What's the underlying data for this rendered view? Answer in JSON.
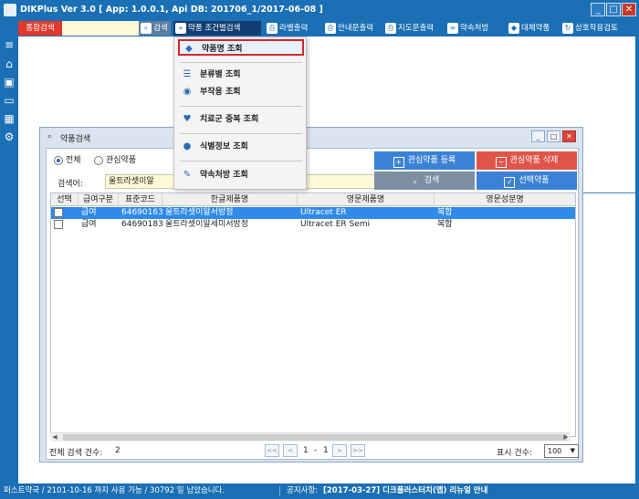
{
  "window": {
    "title": "DIKPlus Ver 3.0 [ App: 1.0.0.1, Api DB: 201706_1/2017-06-08 ]",
    "controls": [
      "_",
      "□",
      "✕"
    ]
  },
  "toolbar": {
    "integrated_search": "통합검색",
    "search": "검색",
    "drug_condition_search": "약품 조건별검색",
    "label_print": "라벨출력",
    "guide_print": "안내문출력",
    "instruction_print": "지도문출력",
    "promise_prescription": "약속처방",
    "substitute_drug": "대체약품",
    "interaction_check": "상호작용검토"
  },
  "menu": {
    "items": [
      {
        "label": "약품명 조회",
        "icon": "pill-tag-icon"
      },
      {
        "label": "분류별 조회",
        "icon": "list-icon"
      },
      {
        "label": "부작용 조회",
        "icon": "eye-icon"
      },
      {
        "label": "치료군 중복 조회",
        "icon": "heart-icon"
      },
      {
        "label": "식별정보 조회",
        "icon": "capsule-icon"
      },
      {
        "label": "약속처방 조회",
        "icon": "edit-icon"
      }
    ]
  },
  "dialog": {
    "title": "약품검색",
    "radio_all": "전체",
    "radio_favorite": "관심약품",
    "btn_register_favorite": "관심약품 등록",
    "btn_delete_favorite": "관심약품 삭제",
    "search_label": "검색어:",
    "search_value": "울트라셋이알",
    "btn_search": "검색",
    "btn_select": "선택약품",
    "columns": [
      "선택",
      "급여구분",
      "표준코드",
      "한글제품명",
      "영문제품명",
      "영문성분명"
    ],
    "rows": [
      {
        "coverage": "급여",
        "code": "64690163",
        "kr_name": "울트라셋이알서방정",
        "en_name": "Ultracet ER",
        "ingredient": "복합"
      },
      {
        "coverage": "급여",
        "code": "64690183",
        "kr_name": "울트라셋이알세미서방정",
        "en_name": "Ultracet ER Semi",
        "ingredient": "복합"
      }
    ],
    "total_label": "전체 검색 건수:",
    "total_count": "2",
    "pager": {
      "first": "<<",
      "prev": "<",
      "current": "1",
      "dash": "-",
      "last_page": "1",
      "next": ">",
      "last": ">>"
    },
    "show_label": "표시 건수:",
    "show_value": "100"
  },
  "status": {
    "license": "퍼스트약국 / 2101-10-16 까지 사용 가능 / 30792 일 남았습니다.",
    "notice_label": "공지사항:",
    "notice_text": "[2017-03-27] 디크플러스터치(앱) 리뉴얼 안내"
  },
  "colors": {
    "brand": "#1a6fb5",
    "accent_red": "#e03a2e",
    "selected_row": "#2f8ae8",
    "highlight_border": "#d8262d"
  }
}
